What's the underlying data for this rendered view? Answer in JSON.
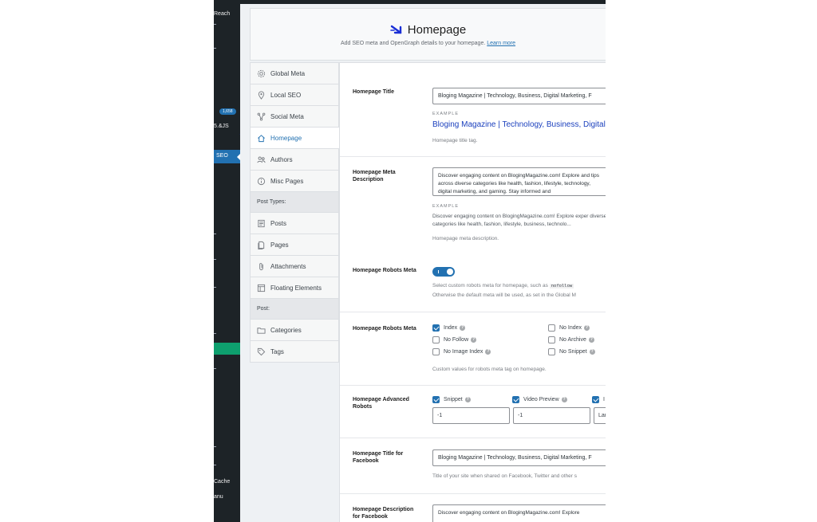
{
  "wp_sidebar": {
    "fragments": [
      "Reach",
      "5.&JS",
      "SEO",
      "Cache",
      "anu"
    ],
    "badge": "1,658"
  },
  "header": {
    "title": "Homepage",
    "subtitle": "Add SEO meta and OpenGraph details to your homepage.",
    "learn_more": "Learn more"
  },
  "sidebar": {
    "items": [
      {
        "label": "Global Meta",
        "icon": "gear-icon"
      },
      {
        "label": "Local SEO",
        "icon": "map-pin-icon"
      },
      {
        "label": "Social Meta",
        "icon": "share-icon"
      },
      {
        "label": "Homepage",
        "icon": "home-icon",
        "active": true
      },
      {
        "label": "Authors",
        "icon": "users-icon"
      },
      {
        "label": "Misc Pages",
        "icon": "info-circle-icon"
      }
    ],
    "post_types_heading": "Post Types:",
    "post_type_items": [
      {
        "label": "Posts",
        "icon": "post-icon"
      },
      {
        "label": "Pages",
        "icon": "page-icon"
      },
      {
        "label": "Attachments",
        "icon": "paperclip-icon"
      },
      {
        "label": "Floating Elements",
        "icon": "layout-icon"
      }
    ],
    "post_heading": "Post:",
    "post_items": [
      {
        "label": "Categories",
        "icon": "folder-icon"
      },
      {
        "label": "Tags",
        "icon": "tag-icon"
      }
    ]
  },
  "fields": {
    "homepage_title": {
      "label": "Homepage Title",
      "value": "Bloging Magazine | Technology, Business, Digital Marketing, F",
      "example_label": "EXAMPLE",
      "example_title": "Bloging Magazine | Technology, Business, Digital",
      "help": "Homepage title tag."
    },
    "meta_description": {
      "label": "Homepage Meta Description",
      "value": "Discover engaging content on BlogingMagazine.com! Explore and tips across diverse categories like health, fashion, lifestyle, technology, digital marketing, and gaming. Stay informed and",
      "example_label": "EXAMPLE",
      "example_desc": "Discover engaging content on BlogingMagazine.com! Explore exper diverse categories like health, fashion, lifestyle, business, technolo...",
      "help": "Homepage meta description."
    },
    "robots_meta_toggle": {
      "label": "Homepage Robots Meta",
      "help_line1_a": "Select custom robots meta for homepage, such as",
      "help_code": "nofollow",
      "help_line2": "Otherwise the default meta will be used, as set in the Global M"
    },
    "robots_meta": {
      "label": "Homepage Robots Meta",
      "options": [
        {
          "label": "Index",
          "checked": true
        },
        {
          "label": "No Index",
          "checked": false
        },
        {
          "label": "No Follow",
          "checked": false
        },
        {
          "label": "No Archive",
          "checked": false
        },
        {
          "label": "No Image Index",
          "checked": false
        },
        {
          "label": "No Snippet",
          "checked": false
        }
      ],
      "help": "Custom values for robots meta tag on homepage."
    },
    "advanced_robots": {
      "label": "Homepage Advanced Robots",
      "options": [
        {
          "label": "Snippet",
          "checked": true
        },
        {
          "label": "Video Preview",
          "checked": true
        },
        {
          "label": "I",
          "checked": true
        }
      ],
      "inputs": [
        "-1",
        "-1",
        "Larg"
      ]
    },
    "facebook_title": {
      "label": "Homepage Title for Facebook",
      "value": "Bloging Magazine | Technology, Business, Digital Marketing, F",
      "help": "Title of your site when shared on Facebook, Twitter and other s"
    },
    "facebook_description": {
      "label": "Homepage Description for Facebook",
      "value": "Discover engaging content on BlogingMagazine.com! Explore"
    }
  },
  "colors": {
    "accent": "#2271b1",
    "example_link": "#1a3fbd",
    "wp_dark": "#1d2327",
    "annotation": "#1a2fd6"
  }
}
